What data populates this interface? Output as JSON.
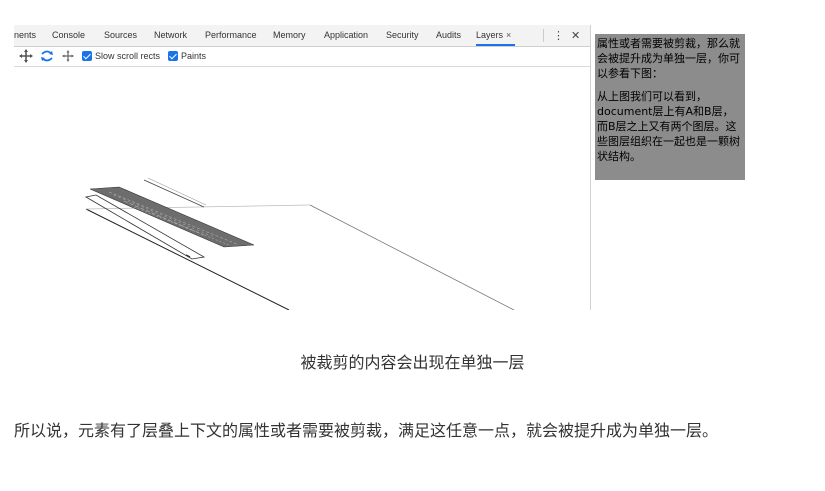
{
  "devtools": {
    "tabs": [
      {
        "label": "nents",
        "active": false
      },
      {
        "label": "Console",
        "active": false
      },
      {
        "label": "Sources",
        "active": false
      },
      {
        "label": "Network",
        "active": false
      },
      {
        "label": "Performance",
        "active": false
      },
      {
        "label": "Memory",
        "active": false
      },
      {
        "label": "Application",
        "active": false
      },
      {
        "label": "Security",
        "active": false
      },
      {
        "label": "Audits",
        "active": false
      },
      {
        "label": "Layers",
        "active": true
      }
    ],
    "tab_close_glyph": "×",
    "menu_glyph": "⋮",
    "close_glyph": "✕",
    "toolbar": {
      "tools": [
        "pan-icon",
        "rotate-icon",
        "move-icon"
      ],
      "checkboxes": [
        {
          "label": "Slow scroll rects",
          "checked": true
        },
        {
          "label": "Paints",
          "checked": true
        }
      ]
    },
    "accent_color": "#1a73e8"
  },
  "layer_panel": {
    "paragraphs": [
      "属性或者需要被剪裁，那么就会被提升成为单独一层，你可以参看下图：",
      "从上图我们可以看到，document层上有A和B层，而B层之上又有两个图层。这些图层组织在一起也是一颗树状结构。"
    ],
    "background": "#8c8c8c"
  },
  "caption": "被裁剪的内容会出现在单独一层",
  "paragraph": "所以说，元素有了层叠上下文的属性或者需要被剪裁，满足这任意一点，就会被提升成为单独一层。"
}
